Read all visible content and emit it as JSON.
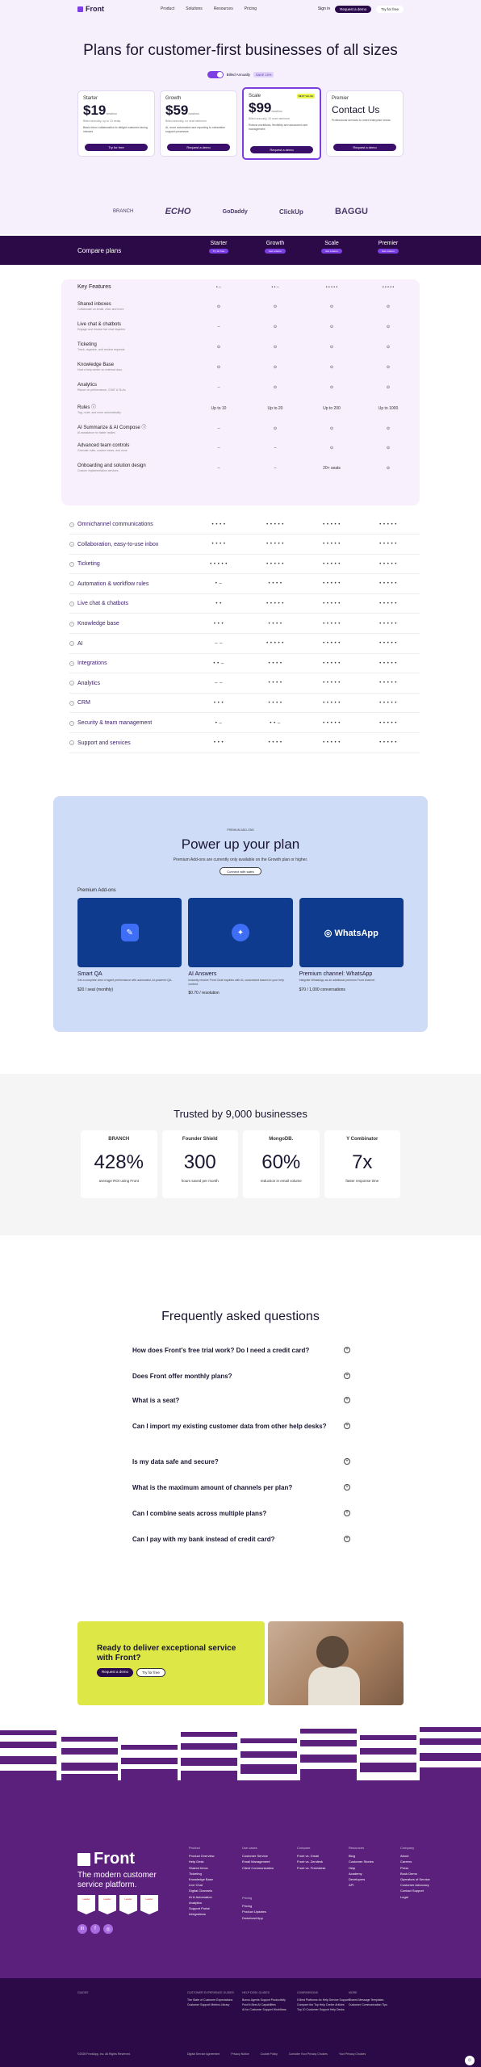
{
  "nav": {
    "logo": "Front",
    "links": [
      "Product",
      "Solutions",
      "Resources",
      "Pricing"
    ],
    "signin": "Sign in",
    "demo": "Request a demo",
    "trial": "Try for free"
  },
  "hero": {
    "title": "Plans for customer-first businesses of all sizes",
    "billing": "Billed Annually",
    "save": "SAVE 15%"
  },
  "plans": [
    {
      "name": "Starter",
      "price": "$19",
      "per": "/seat/mo",
      "sub": "Billed annually, up to 10 seats",
      "desc": "Basic inbox collaboration to delight customer-facing inboxes",
      "cta": "Try for free"
    },
    {
      "name": "Growth",
      "price": "$59",
      "per": "/seat/mo",
      "sub": "Billed annually, no seat minimum",
      "desc": "AI, more automation and reporting to streamline support processes",
      "cta": "Request a demo"
    },
    {
      "name": "Scale",
      "price": "$99",
      "per": "/seat/mo",
      "sub": "Billed annually, 20 seat minimum",
      "desc": "Robust workflows, flexibility and advanced user management",
      "cta": "Request a demo",
      "badge": "BEST VALUE"
    },
    {
      "name": "Premier",
      "price": "Contact Us",
      "sub": "",
      "desc": "Professional services to meet enterprise needs",
      "cta": "Request a demo"
    }
  ],
  "logos": [
    "BRANCH",
    "ECHO",
    "GoDaddy",
    "ClickUp",
    "BAGGU"
  ],
  "compare": {
    "label": "Compare plans",
    "cols": [
      "Starter",
      "Growth",
      "Scale",
      "Premier"
    ],
    "btns": [
      "Try for free",
      "Get a demo",
      "Get a demo",
      "Get a demo"
    ]
  },
  "key_features": {
    "title": "Key Features",
    "header": [
      "• –",
      "• • –",
      "• • • • •",
      "• • • • •"
    ],
    "rows": [
      {
        "name": "Shared inboxes",
        "sub": "Collaborate on email, chat, and more",
        "cells": [
          "⊙",
          "⊙",
          "⊙",
          "⊙"
        ]
      },
      {
        "name": "Live chat & chatbots",
        "sub": "Engage and resolve live chat inquiries",
        "cells": [
          "–",
          "⊙",
          "⊙",
          "⊙"
        ]
      },
      {
        "name": "Ticketing",
        "sub": "Track, organize, and resolve requests",
        "cells": [
          "⊙",
          "⊙",
          "⊙",
          "⊙"
        ]
      },
      {
        "name": "Knowledge Base",
        "sub": "Host a help center on external docs",
        "cells": [
          "⊙",
          "⊙",
          "⊙",
          "⊙"
        ]
      },
      {
        "name": "Analytics",
        "sub": "Report on performance, CSAT & SLAs",
        "cells": [
          "–",
          "⊙",
          "⊙",
          "⊙"
        ]
      },
      {
        "name": "Rules ⓘ",
        "sub": "Tag, route, and more automatically",
        "cells": [
          "Up to 10",
          "Up to 20",
          "Up to 200",
          "Up to 1000"
        ]
      },
      {
        "name": "AI Summarize & AI Compose ⓘ",
        "sub": "AI assistance for faster replies",
        "cells": [
          "–",
          "⊙",
          "⊙",
          "⊙"
        ]
      },
      {
        "name": "Advanced team controls",
        "sub": "Granular roles, custom views, and more",
        "cells": [
          "–",
          "–",
          "⊙",
          "⊙"
        ]
      },
      {
        "name": "Onboarding and solution design",
        "sub": "Custom implementation services",
        "cells": [
          "–",
          "–",
          "20+ seats",
          "⊙"
        ]
      }
    ]
  },
  "categories": [
    {
      "name": "Omnichannel communications",
      "cells": [
        "• • • •",
        "• • • • •",
        "• • • • •",
        "• • • • •"
      ]
    },
    {
      "name": "Collaboration, easy-to-use inbox",
      "cells": [
        "• • • •",
        "• • • • •",
        "• • • • •",
        "• • • • •"
      ]
    },
    {
      "name": "Ticketing",
      "cells": [
        "• • • • •",
        "• • • • •",
        "• • • • •",
        "• • • • •"
      ]
    },
    {
      "name": "Automation & workflow rules",
      "cells": [
        "• –",
        "• • • •",
        "• • • • •",
        "• • • • •"
      ]
    },
    {
      "name": "Live chat & chatbots",
      "cells": [
        "• •",
        "• • • • •",
        "• • • • •",
        "• • • • •"
      ]
    },
    {
      "name": "Knowledge base",
      "cells": [
        "• • •",
        "• • • •",
        "• • • • •",
        "• • • • •"
      ]
    },
    {
      "name": "AI",
      "cells": [
        "– –",
        "• • • • •",
        "• • • • •",
        "• • • • •"
      ]
    },
    {
      "name": "Integrations",
      "cells": [
        "• • –",
        "• • • •",
        "• • • • •",
        "• • • • •"
      ]
    },
    {
      "name": "Analytics",
      "cells": [
        "– –",
        "• • • •",
        "• • • • •",
        "• • • • •"
      ]
    },
    {
      "name": "CRM",
      "cells": [
        "• • •",
        "• • • •",
        "• • • • •",
        "• • • • •"
      ]
    },
    {
      "name": "Security & team management",
      "cells": [
        "• –",
        "• • –",
        "• • • • •",
        "• • • • •"
      ]
    },
    {
      "name": "Support and services",
      "cells": [
        "• • •",
        "• • • •",
        "• • • • •",
        "• • • • •"
      ]
    }
  ],
  "addons": {
    "eyebrow": "PREMIUM ADD-ONS",
    "title": "Power up your plan",
    "desc": "Premium Add-ons are currently only available on the Growth plan or higher.",
    "cta": "Connect with sales",
    "section": "Premium Add-ons",
    "items": [
      {
        "title": "Smart QA",
        "desc": "Get a complete view of agent performance with automated, AI-powered QA.",
        "price": "$20 / seat (monthly)",
        "icon": "qa-icon"
      },
      {
        "title": "AI Answers",
        "desc": "Instantly resolve Front Chat inquiries with AI, customized based on your help content.",
        "price": "$0.70 / resolution",
        "icon": "sparkle-icon"
      },
      {
        "title": "Premium channel: WhatsApp",
        "desc": "Integrate WhatsApp as an additional premium Front channel.",
        "price": "$70 / 1,000 conversations",
        "icon": "whatsapp-icon",
        "label": "WhatsApp"
      }
    ]
  },
  "trusted": {
    "title": "Trusted by 9,000 businesses",
    "stats": [
      {
        "logo": "BRANCH",
        "num": "428%",
        "lbl": "average ROI using Front"
      },
      {
        "logo": "Founder Shield",
        "num": "300",
        "lbl": "hours saved per month"
      },
      {
        "logo": "MongoDB.",
        "num": "60%",
        "lbl": "reduction in email volume"
      },
      {
        "logo": "Y Combinator",
        "num": "7x",
        "lbl": "faster response time"
      }
    ]
  },
  "faq": {
    "title": "Frequently asked questions",
    "items": [
      "How does Front's free trial work? Do I need a credit card?",
      "Does Front offer monthly plans?",
      "What is a seat?",
      "Can I import my existing customer data from other help desks?",
      "Is my data safe and secure?",
      "What is the maximum amount of channels per plan?",
      "Can I combine seats across multiple plans?",
      "Can I pay with my bank instead of credit card?"
    ]
  },
  "banner": {
    "title": "Ready to deliver exceptional service with Front?",
    "demo": "Request a demo",
    "trial": "Try for free"
  },
  "footer": {
    "logo": "Front",
    "tagline": "The modern customer service platform.",
    "cols": [
      {
        "head": "Product",
        "items": [
          "Product Overview",
          "Help Desk",
          "Shared Inbox",
          "Ticketing",
          "Knowledge Base",
          "Live Chat",
          "Digital Channels",
          "AI & Automation",
          "Analytics",
          "Support Portal",
          "Integrations"
        ]
      },
      {
        "head": "Use cases",
        "items": [
          "Customer Service",
          "Email Management",
          "Client Communication"
        ]
      },
      {
        "head": "Pricing",
        "items": [
          "Pricing",
          "Product Updates",
          "Download App"
        ]
      },
      {
        "head": "Compare",
        "items": [
          "Front vs. Gmail",
          "Front vs. Zendesk",
          "Front vs. Freshdesk"
        ]
      },
      {
        "head": "Resources",
        "items": [
          "Blog",
          "Customer Stories",
          "Help",
          "Academy",
          "Developers",
          "API"
        ]
      },
      {
        "head": "Company",
        "items": [
          "About",
          "Careers",
          "Press",
          "Book Demo",
          "Operators of Service",
          "Customer Advocacy",
          "Contact Support",
          "Legal"
        ]
      }
    ],
    "bottom": [
      {
        "head": "GUIDES",
        "items": []
      },
      {
        "head": "CUSTOMER EXPERIENCE GUIDES",
        "items": [
          "The State of Customer Expectations",
          "Customer Support Metrics Library"
        ]
      },
      {
        "head": "HELP DESK GUIDES",
        "items": [
          "Bonus Agents Support Productivity",
          "Front's Best AI Capabilities",
          "AI for Customer Support Workflows"
        ]
      },
      {
        "head": "COMPARISONS",
        "items": [
          "5 Best Platforms for Help Service Support",
          "Compare the Top Help Center Articles",
          "Top 10 Customer Support Help Desks"
        ]
      },
      {
        "head": "MORE",
        "items": [
          "Shared Message Templates",
          "Customer Communication Tips"
        ]
      }
    ],
    "copyright": "©2025 FrontApp, Inc. All Rights Reserved.",
    "links": [
      "Digital Service Agreement",
      "Privacy Notice",
      "Cookie Policy",
      "Consider Your Privacy Choices",
      "Your Privacy Choices"
    ]
  }
}
